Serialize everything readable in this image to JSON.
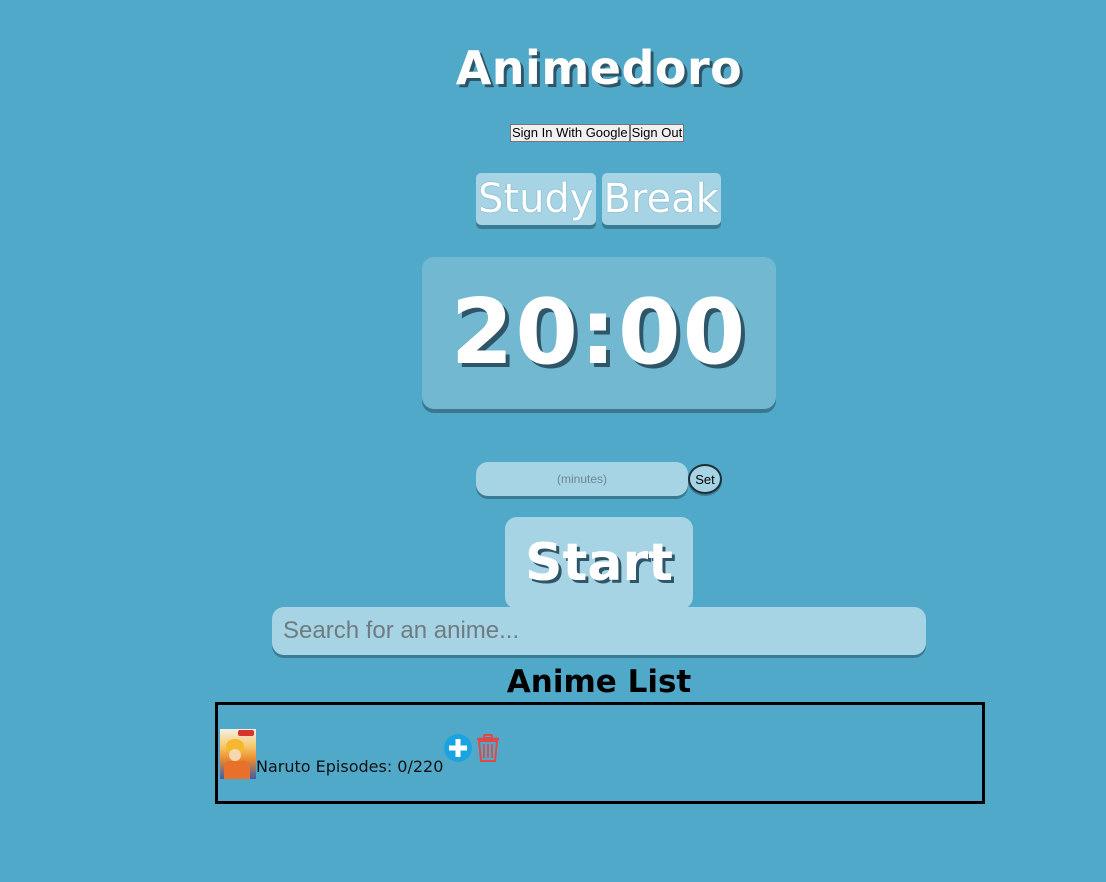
{
  "app": {
    "title": "Animedoro"
  },
  "auth": {
    "sign_in_label": "Sign In With Google",
    "sign_out_label": "Sign Out"
  },
  "modes": {
    "study_label": "Study",
    "break_label": "Break"
  },
  "timer": {
    "display": "20:00"
  },
  "minutes": {
    "placeholder": "(minutes)",
    "set_label": "Set"
  },
  "controls": {
    "start_label": "Start"
  },
  "search": {
    "placeholder": "Search for an anime..."
  },
  "anime_list": {
    "heading": "Anime List",
    "items": [
      {
        "text": "Naruto Episodes: 0/220",
        "thumbnail": "naruto-poster",
        "add_icon": "plus-circle-icon",
        "delete_icon": "trash-icon"
      }
    ]
  },
  "colors": {
    "background": "#51a9c9",
    "panel": "#a6d4e4",
    "timer_panel": "#72b8d0",
    "add_icon": "#1aa3e0",
    "delete_icon": "#e04848"
  }
}
